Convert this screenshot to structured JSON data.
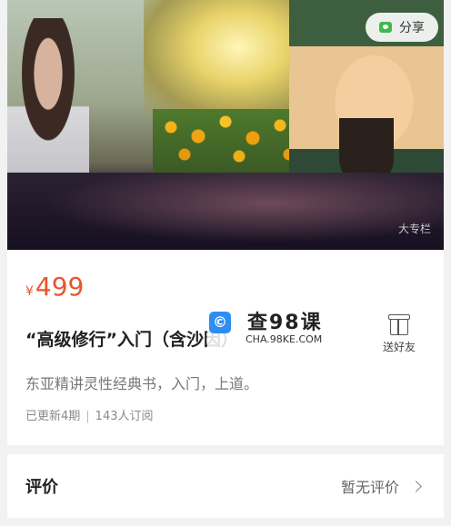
{
  "header": {
    "share_label": "分享",
    "banner_badge": "大专栏"
  },
  "product": {
    "currency": "¥",
    "price": "499",
    "title": "“高级修行”入门（含沙因）",
    "gift_label": "送好友",
    "description": "东亚精讲灵性经典书，入门，上道。",
    "updated": "已更新4期",
    "subscribers": "143人订阅"
  },
  "watermark": {
    "logo_char": "©",
    "name": "查98课",
    "site": "CHA.98KE.COM"
  },
  "review": {
    "label": "评价",
    "status": "暂无评价"
  },
  "colors": {
    "price": "#e8562e",
    "share_icon": "#3dba4e"
  }
}
